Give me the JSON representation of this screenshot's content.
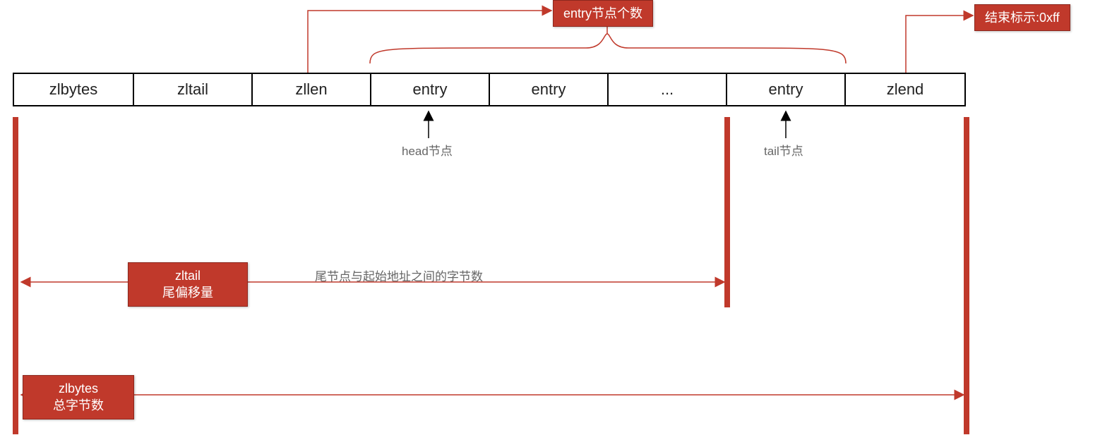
{
  "cells": {
    "zlbytes": "zlbytes",
    "zltail": "zltail",
    "zllen": "zllen",
    "entry1": "entry",
    "entry2": "entry",
    "ellipsis": "...",
    "entryN": "entry",
    "zlend": "zlend"
  },
  "labels": {
    "entryCount": "entry节点个数",
    "endMark": "结束标示:0xff",
    "headNode": "head节点",
    "tailNode": "tail节点",
    "zltailTitle": "zltail",
    "zltailSub": "尾偏移量",
    "zltailDesc": "尾节点与起始地址之间的字节数",
    "zlbytesTitle": "zlbytes",
    "zlbytesSub": "总字节数"
  }
}
